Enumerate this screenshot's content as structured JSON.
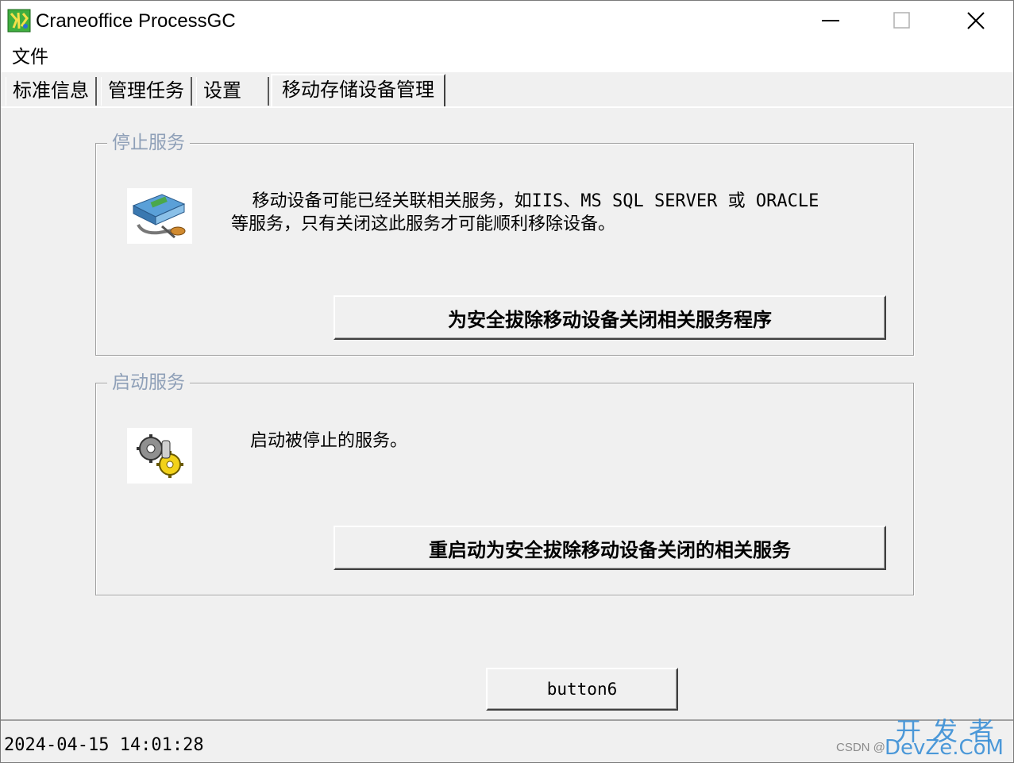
{
  "window": {
    "title": "Craneoffice ProcessGC",
    "controls": {
      "minimize": "minimize-icon",
      "maximize": "maximize-icon",
      "close": "close-icon"
    }
  },
  "menu": {
    "items": [
      {
        "label": "文件"
      }
    ]
  },
  "tabs": [
    {
      "label": "标准信息",
      "active": false
    },
    {
      "label": "管理任务",
      "active": false
    },
    {
      "label": "设置",
      "active": false
    },
    {
      "label": "移动存储设备管理",
      "active": true
    }
  ],
  "stop_group": {
    "legend": "停止服务",
    "description_line1": "  移动设备可能已经关联相关服务，如IIS、MS SQL SERVER 或 ORACLE",
    "description_line2": "等服务，只有关闭这此服务才可能顺利移除设备。",
    "button_label": "为安全拔除移动设备关闭相关服务程序",
    "icon": "drive-tools-icon"
  },
  "start_group": {
    "legend": "启动服务",
    "description": "启动被停止的服务。",
    "button_label": "重启动为安全拔除移动设备关闭的相关服务",
    "icon": "gears-icon"
  },
  "footer_button": {
    "label": "button6"
  },
  "status": {
    "datetime": "2024-04-15 14:01:28"
  },
  "watermark": {
    "cn": "开发者",
    "en": "DevZe.CoM",
    "csdn": "CSDN @"
  },
  "colors": {
    "legend_text": "#8fa0b8",
    "window_bg": "#f0f0f0",
    "watermark": "#3a8fd6"
  }
}
